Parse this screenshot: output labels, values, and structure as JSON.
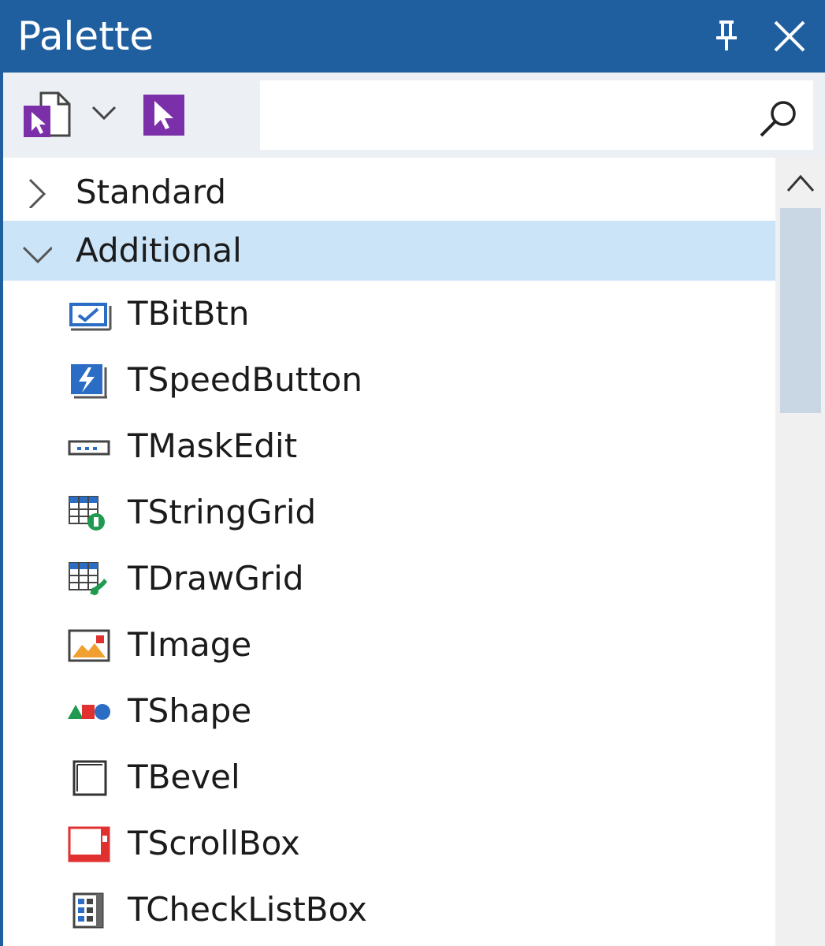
{
  "window": {
    "title": "Palette",
    "pin_icon": "pin-icon",
    "close_icon": "close-icon"
  },
  "toolbar": {
    "multi_select_icon": "multi-select-icon",
    "dropdown_icon": "chevron-down-icon",
    "select_icon": "select-pointer-icon",
    "search": {
      "value": "",
      "placeholder": "",
      "icon": "search-icon"
    }
  },
  "tree": {
    "categories": [
      {
        "label": "Standard",
        "expanded": false,
        "selected": false
      },
      {
        "label": "Additional",
        "expanded": true,
        "selected": true
      }
    ],
    "items": [
      {
        "label": "TBitBtn",
        "icon": "bitbtn-icon"
      },
      {
        "label": "TSpeedButton",
        "icon": "speedbutton-icon"
      },
      {
        "label": "TMaskEdit",
        "icon": "maskedit-icon"
      },
      {
        "label": "TStringGrid",
        "icon": "stringgrid-icon"
      },
      {
        "label": "TDrawGrid",
        "icon": "drawgrid-icon"
      },
      {
        "label": "TImage",
        "icon": "image-icon"
      },
      {
        "label": "TShape",
        "icon": "shape-icon"
      },
      {
        "label": "TBevel",
        "icon": "bevel-icon"
      },
      {
        "label": "TScrollBox",
        "icon": "scrollbox-icon"
      },
      {
        "label": "TCheckListBox",
        "icon": "checklistbox-icon"
      }
    ]
  },
  "colors": {
    "titlebar": "#1f5f9f",
    "selected_row": "#cce4f7",
    "toolbar": "#eceff4",
    "accent_purple": "#7b2fa8"
  }
}
